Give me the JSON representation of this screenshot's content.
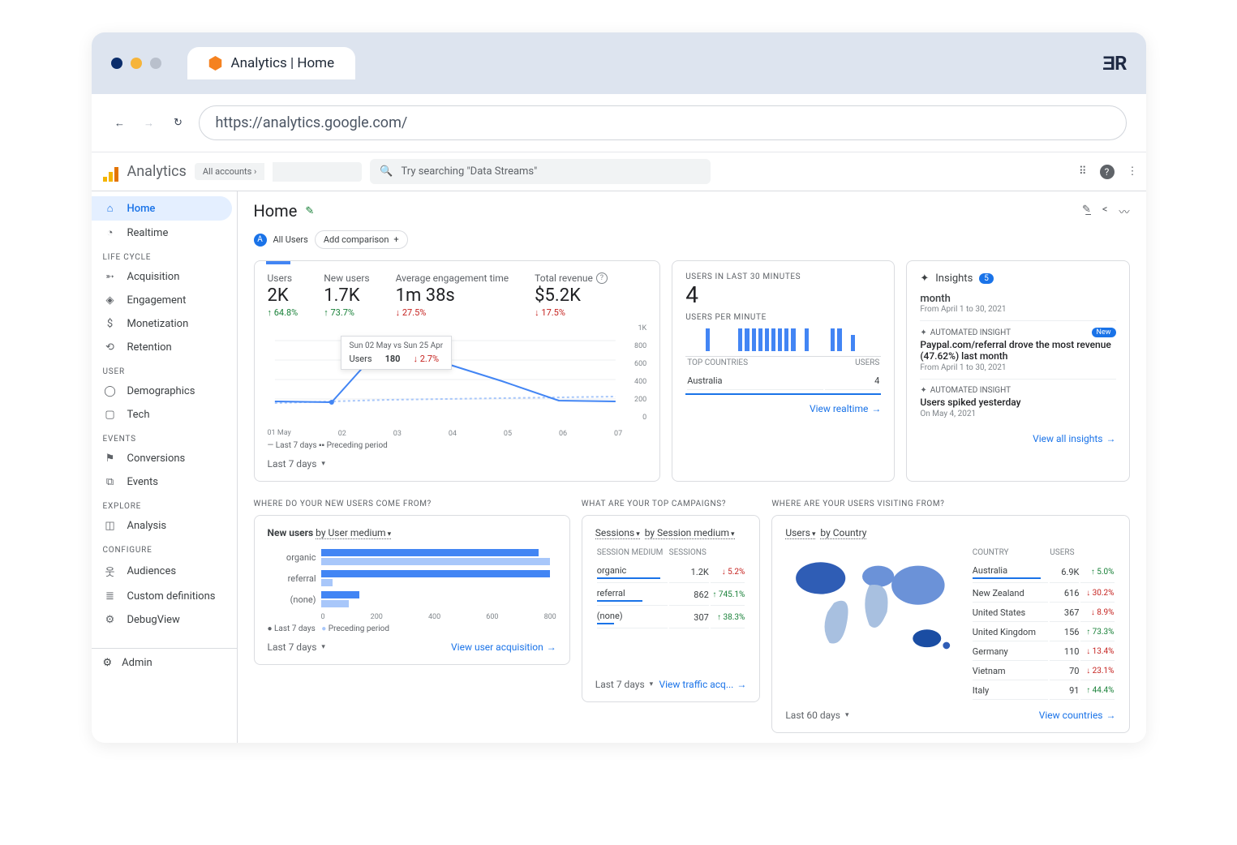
{
  "browser": {
    "tab_title": "Analytics | Home",
    "url": "https://analytics.google.com/"
  },
  "app": {
    "name": "Analytics",
    "accounts_crumb": "All accounts ›",
    "search_placeholder": "Try searching \"Data Streams\""
  },
  "sidebar": {
    "items": [
      "Home",
      "Realtime"
    ],
    "sections": [
      {
        "label": "LIFE CYCLE",
        "items": [
          "Acquisition",
          "Engagement",
          "Monetization",
          "Retention"
        ]
      },
      {
        "label": "USER",
        "items": [
          "Demographics",
          "Tech"
        ]
      },
      {
        "label": "EVENTS",
        "items": [
          "Conversions",
          "Events"
        ]
      },
      {
        "label": "EXPLORE",
        "items": [
          "Analysis"
        ]
      },
      {
        "label": "CONFIGURE",
        "items": [
          "Audiences",
          "Custom definitions",
          "DebugView"
        ]
      }
    ],
    "admin": "Admin"
  },
  "page": {
    "title": "Home",
    "segment_label": "All Users",
    "add_comparison": "Add comparison"
  },
  "chart_data": [
    {
      "type": "line",
      "title": "Users last 7 days",
      "kpis": [
        {
          "label": "Users",
          "value": "2K",
          "delta": "64.8%",
          "dir": "up"
        },
        {
          "label": "New users",
          "value": "1.7K",
          "delta": "73.7%",
          "dir": "up"
        },
        {
          "label": "Average engagement time",
          "value": "1m 38s",
          "delta": "27.5%",
          "dir": "down"
        },
        {
          "label": "Total revenue",
          "value": "$5.2K",
          "delta": "17.5%",
          "dir": "down",
          "info": true
        }
      ],
      "x": [
        "01 May",
        "02",
        "03",
        "04",
        "05",
        "06",
        "07"
      ],
      "series": [
        {
          "name": "Last 7 days",
          "values": [
            220,
            220,
            850,
            610,
            420,
            260,
            230
          ]
        },
        {
          "name": "Preceding period",
          "values": [
            210,
            220,
            230,
            235,
            240,
            245,
            250
          ]
        }
      ],
      "ylim": [
        0,
        1000
      ],
      "yticks": [
        "1K",
        "800",
        "600",
        "400",
        "200",
        "0"
      ],
      "tooltip": {
        "title": "Sun 02 May vs Sun 25 Apr",
        "metric": "Users",
        "value": "180",
        "delta": "2.7%"
      },
      "legend": "— Last 7 days  ▪▪ Preceding period",
      "range": "Last 7 days"
    },
    {
      "type": "bar",
      "title": "USERS IN LAST 30 MINUTES",
      "big": "4",
      "subtitle": "USERS PER MINUTE",
      "values": [
        0,
        0,
        0,
        14,
        0,
        0,
        0,
        0,
        14,
        14,
        14,
        14,
        14,
        14,
        14,
        14,
        14,
        0,
        14,
        0,
        0,
        0,
        14,
        14,
        0,
        10,
        0,
        0,
        0,
        0
      ],
      "country_header": [
        "TOP COUNTRIES",
        "USERS"
      ],
      "rows": [
        {
          "country": "Australia",
          "users": "4"
        }
      ],
      "link": "View realtime"
    },
    {
      "type": "bar",
      "title": "WHERE DO YOUR NEW USERS COME FROM?",
      "dim_label_1": "New users",
      "dim_label_2": "by User medium",
      "categories": [
        "organic",
        "referral",
        "(none)"
      ],
      "series": [
        {
          "name": "Last 7 days",
          "values": [
            740,
            780,
            130
          ]
        },
        {
          "name": "Preceding period",
          "values": [
            780,
            40,
            95
          ]
        }
      ],
      "xlim": [
        0,
        800
      ],
      "xticks": [
        "0",
        "200",
        "400",
        "600",
        "800"
      ],
      "legend": [
        "Last 7 days",
        "Preceding period"
      ],
      "range": "Last 7 days",
      "link": "View user acquisition"
    },
    {
      "type": "table",
      "title": "WHAT ARE YOUR TOP CAMPAIGNS?",
      "dim_label_1": "Sessions",
      "dim_label_2": "by Session medium",
      "headers": [
        "SESSION MEDIUM",
        "SESSIONS",
        ""
      ],
      "rows": [
        {
          "k": "organic",
          "v": "1.2K",
          "d": "5.2%",
          "dir": "down"
        },
        {
          "k": "referral",
          "v": "862",
          "d": "745.1%",
          "dir": "up"
        },
        {
          "k": "(none)",
          "v": "307",
          "d": "38.3%",
          "dir": "up"
        }
      ],
      "range": "Last 7 days",
      "link": "View traffic acq..."
    },
    {
      "type": "table",
      "title": "WHERE ARE YOUR USERS VISITING FROM?",
      "dim_label_1": "Users",
      "dim_label_2": "by Country",
      "headers": [
        "COUNTRY",
        "USERS",
        ""
      ],
      "rows": [
        {
          "k": "Australia",
          "v": "6.9K",
          "d": "5.0%",
          "dir": "up"
        },
        {
          "k": "New Zealand",
          "v": "616",
          "d": "30.2%",
          "dir": "down"
        },
        {
          "k": "United States",
          "v": "367",
          "d": "8.9%",
          "dir": "down"
        },
        {
          "k": "United Kingdom",
          "v": "156",
          "d": "73.3%",
          "dir": "up"
        },
        {
          "k": "Germany",
          "v": "110",
          "d": "13.4%",
          "dir": "down"
        },
        {
          "k": "Vietnam",
          "v": "70",
          "d": "23.1%",
          "dir": "down"
        },
        {
          "k": "Italy",
          "v": "91",
          "d": "44.4%",
          "dir": "up"
        }
      ],
      "range": "Last 60 days",
      "link": "View countries"
    }
  ],
  "insights": {
    "title": "Insights",
    "count": "5",
    "period_label": "month",
    "period_range": "From April 1 to 30, 2021",
    "items": [
      {
        "auto": "AUTOMATED INSIGHT",
        "new": true,
        "text": "Paypal.com/referral drove the most revenue (47.62%) last month",
        "date": "From April 1 to 30, 2021"
      },
      {
        "auto": "AUTOMATED INSIGHT",
        "text": "Users spiked yesterday",
        "date": "On May 4, 2021"
      }
    ],
    "link": "View all insights"
  }
}
